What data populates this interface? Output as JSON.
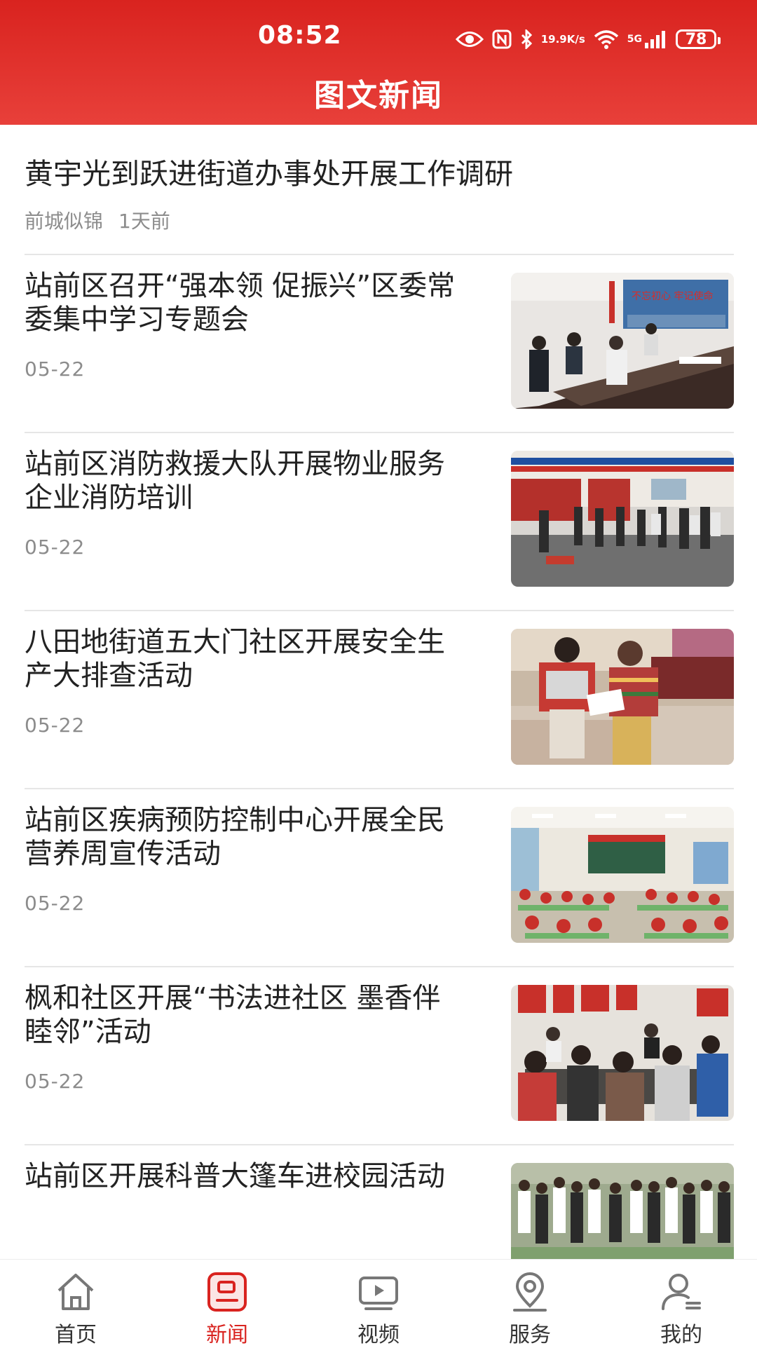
{
  "status_bar": {
    "time": "08:52",
    "network_speed_value": "19.9",
    "network_speed_unit": "K/s",
    "signal_label": "5G",
    "battery": "78",
    "icons": [
      "eye-icon",
      "nfc-icon",
      "bluetooth-icon",
      "wifi-icon",
      "signal-icon",
      "battery-icon"
    ]
  },
  "header": {
    "title": "图文新闻",
    "background_color": "#e0302a"
  },
  "featured": {
    "title": "黄宇光到跃进街道办事处开展工作调研",
    "source": "前城似锦",
    "time": "1天前"
  },
  "news": [
    {
      "title": "站前区召开“强本领 促振兴”区委常委集中学习专题会",
      "date": "05-22",
      "image": "meeting-photo"
    },
    {
      "title": "站前区消防救援大队开展物业服务企业消防培训",
      "date": "05-22",
      "image": "fire-training-photo"
    },
    {
      "title": "八田地街道五大门社区开展安全生产大排查活动",
      "date": "05-22",
      "image": "home-visit-photo"
    },
    {
      "title": "站前区疾病预防控制中心开展全民营养周宣传活动",
      "date": "05-22",
      "image": "classroom-photo"
    },
    {
      "title": "枫和社区开展“书法进社区 墨香伴睦邻”活动",
      "date": "05-22",
      "image": "calligraphy-photo"
    },
    {
      "title": "站前区开展科普大篷车进校园活动",
      "date": "",
      "image": "school-yard-photo"
    }
  ],
  "bottom_nav": {
    "active_color": "#d9231f",
    "items": [
      {
        "label": "首页",
        "icon": "home-icon"
      },
      {
        "label": "新闻",
        "icon": "news-icon",
        "active": true
      },
      {
        "label": "视频",
        "icon": "video-icon"
      },
      {
        "label": "服务",
        "icon": "location-icon"
      },
      {
        "label": "我的",
        "icon": "user-icon"
      }
    ]
  }
}
